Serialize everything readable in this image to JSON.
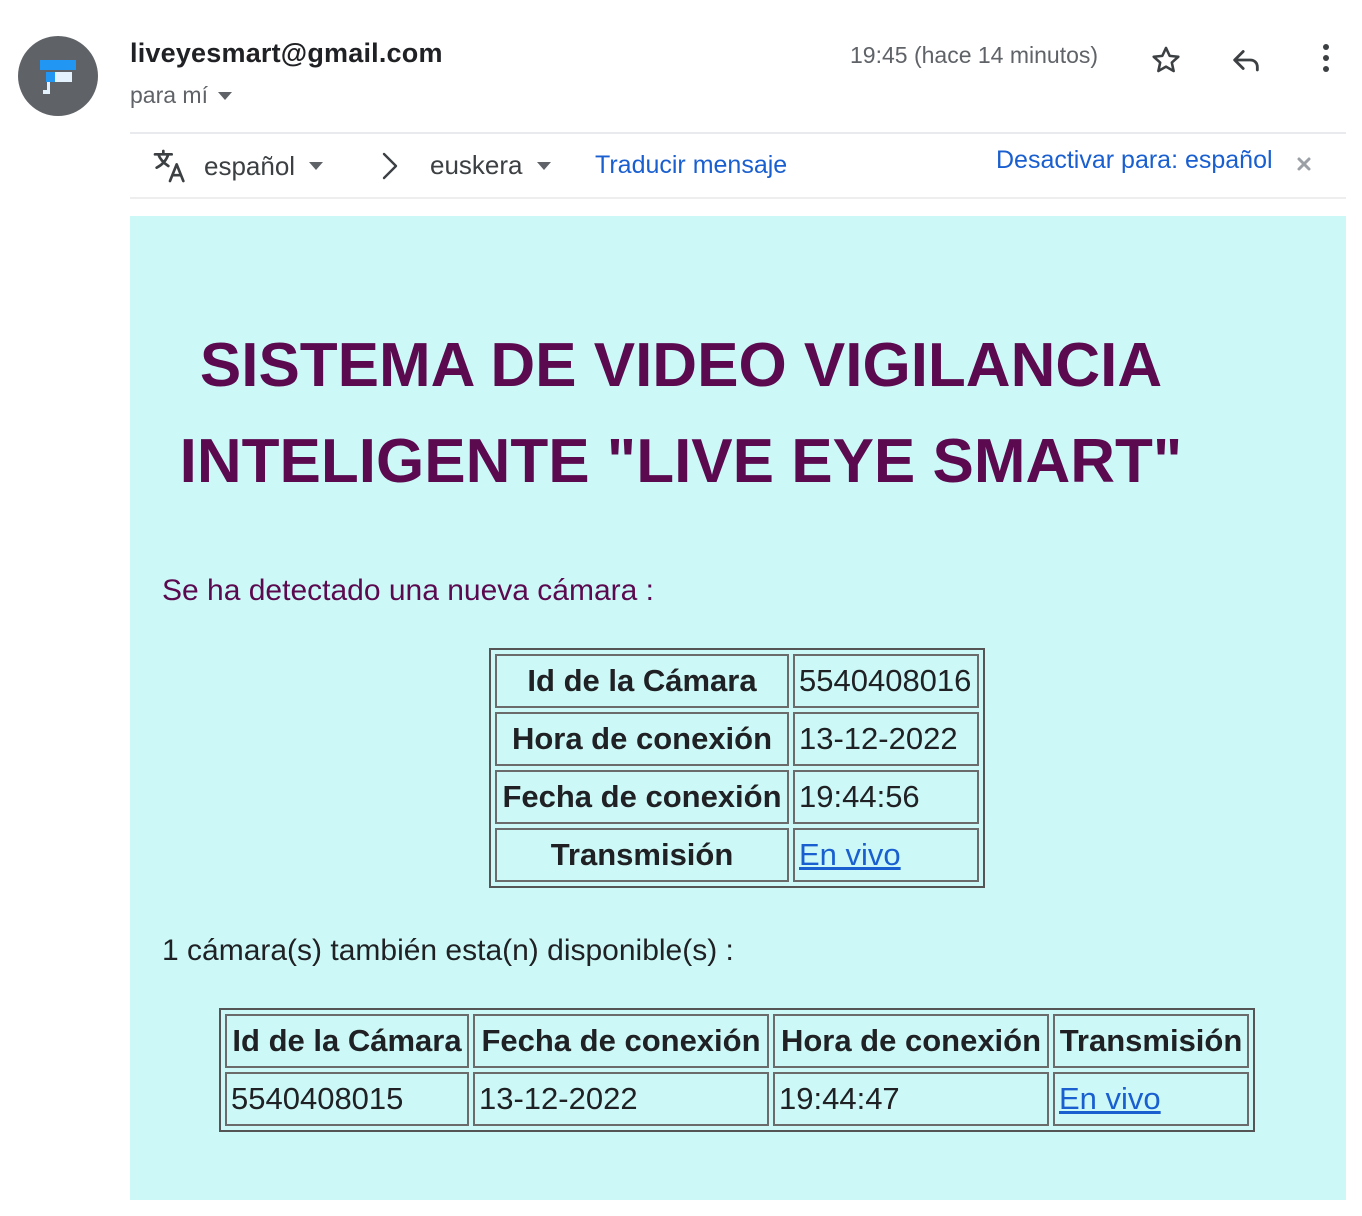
{
  "header": {
    "sender": "liveyesmart@gmail.com",
    "recipient": "para mí",
    "time": "19:45 (hace 14 minutos)"
  },
  "translate_bar": {
    "from_lang": "español",
    "to_lang": "euskera",
    "translate_link": "Traducir mensaje",
    "disable_link": "Desactivar para: español"
  },
  "email": {
    "title_line1": "SISTEMA DE VIDEO VIGILANCIA",
    "title_line2": "INTELIGENTE \"LIVE EYE SMART\"",
    "new_camera_text": "Se ha detectado una nueva cámara :",
    "new_camera_table": {
      "rows": [
        {
          "label": "Id de la Cámara",
          "value": "5540408016"
        },
        {
          "label": "Hora de conexión",
          "value": "13-12-2022"
        },
        {
          "label": "Fecha de conexión",
          "value": "19:44:56"
        },
        {
          "label": "Transmisión",
          "value": "En vivo"
        }
      ]
    },
    "available_text": "1 cámara(s) también esta(n) disponible(s) :",
    "available_table": {
      "headers": [
        "Id de la Cámara",
        "Fecha de conexión",
        "Hora de conexión",
        "Transmisión"
      ],
      "rows": [
        [
          "5540408015",
          "13-12-2022",
          "19:44:47",
          "En vivo"
        ]
      ]
    }
  },
  "colors": {
    "email_background": "#ccf9f7",
    "title_color": "#5b0a50",
    "link_color": "#1a5fd0"
  },
  "icons": [
    "camera-logo-icon",
    "caret-down-icon",
    "star-icon",
    "reply-icon",
    "more-vert-icon",
    "translate-icon",
    "chevron-right-icon",
    "close-icon"
  ]
}
